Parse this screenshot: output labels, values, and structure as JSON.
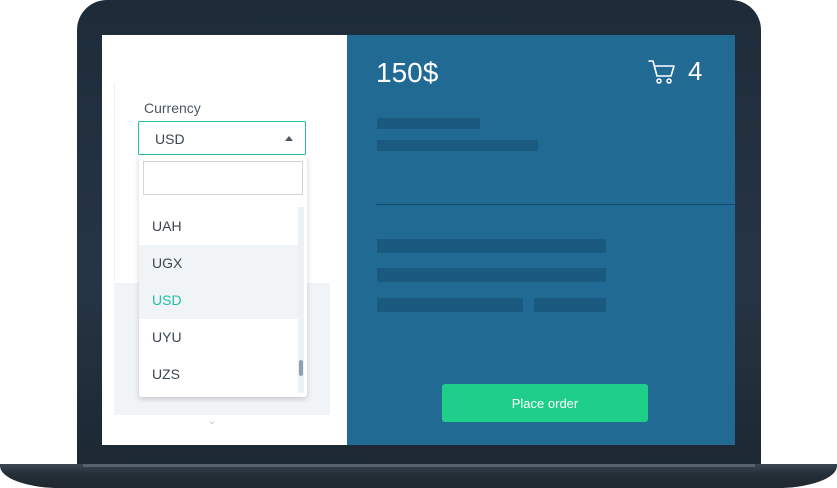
{
  "cart": {
    "price": "150$",
    "count": "4"
  },
  "currency": {
    "label": "Currency",
    "selected": "USD",
    "search_placeholder": "",
    "options": [
      "UAH",
      "UGX",
      "USD",
      "UYU",
      "UZS"
    ],
    "hovered": "UGX"
  },
  "actions": {
    "place_order_label": "Place order"
  },
  "icons": [
    "cart-icon",
    "caret-up-icon",
    "chevron-down-icon"
  ],
  "colors": {
    "accent": "#1fbfa3",
    "primary_bg": "#216a94",
    "button": "#1fcf89"
  }
}
